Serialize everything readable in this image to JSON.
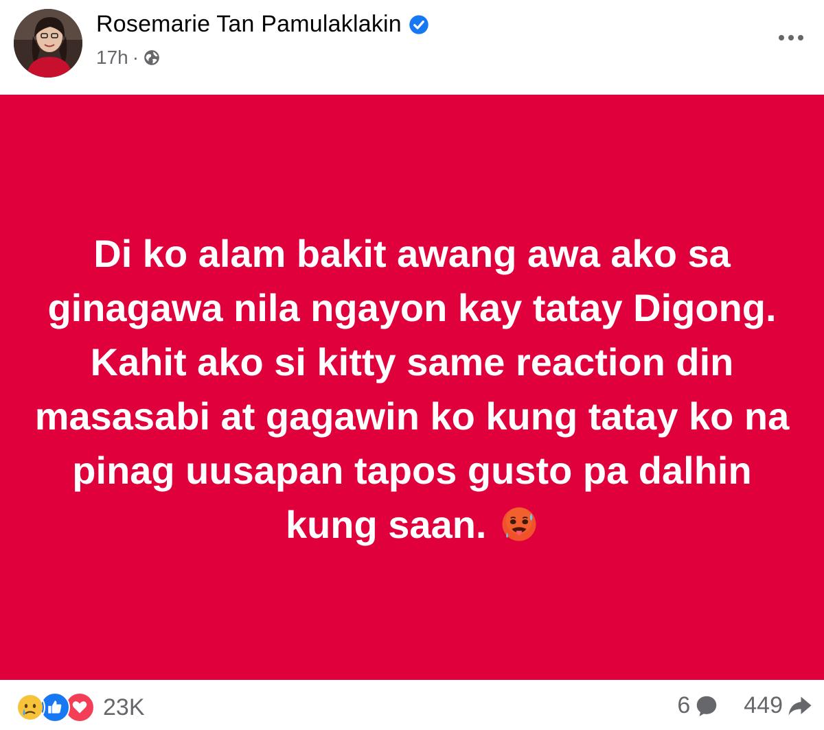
{
  "post": {
    "author_name": "Rosemarie Tan Pamulaklakin",
    "time": "17h",
    "separator": "·",
    "privacy_icon": "globe-icon",
    "more_icon": "more-options-icon",
    "verified_icon": "verified-badge-icon",
    "verified_color": "#1877f2",
    "background_color": "#e0003c",
    "text": "Di ko alam bakit awang awa ako sa ginagawa nila ngayon kay tatay Digong. Kahit ako si kitty same reaction din masasabi at gagawin ko kung tatay ko na pinag uusapan tapos gusto pa dalhin kung saan.",
    "text_emoji": "hot-face-emoji"
  },
  "reactions": {
    "icons": [
      "sad-reaction-icon",
      "like-reaction-icon",
      "love-reaction-icon"
    ],
    "count": "23K"
  },
  "stats": {
    "comments_count": "6",
    "comments_icon": "comment-icon",
    "shares_count": "449",
    "shares_icon": "share-icon"
  }
}
